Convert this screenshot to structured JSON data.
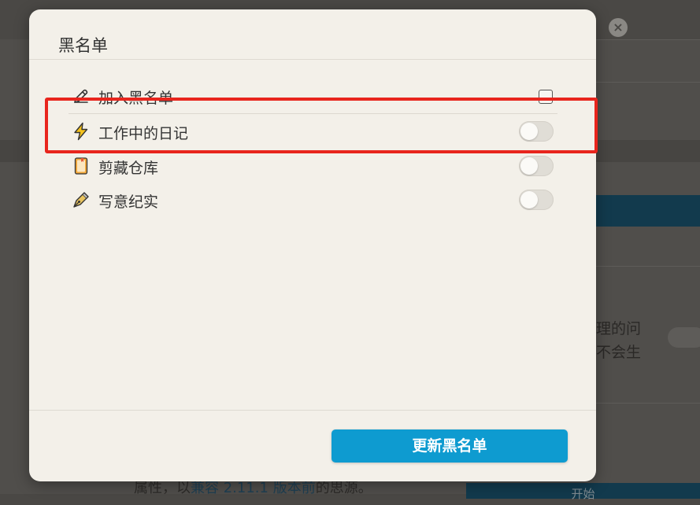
{
  "background": {
    "side_text_1": "理的问",
    "side_text_2": "不会生",
    "footer_before": "属性，以",
    "footer_link": "兼容 2.11.1 版本前",
    "footer_after": "的思源。",
    "bottom_button": "开始"
  },
  "dialog": {
    "title": "黑名单",
    "add_item": {
      "label": "加入黑名单",
      "checked": false,
      "icon": "pencil-icon"
    },
    "notebooks": [
      {
        "label": "工作中的日记",
        "icon": "lightning-icon",
        "enabled": false
      },
      {
        "label": "剪藏仓库",
        "icon": "notebook-icon",
        "enabled": false
      },
      {
        "label": "写意纪实",
        "icon": "fountain-pen-icon",
        "enabled": false
      }
    ],
    "update_button": "更新黑名单"
  },
  "colors": {
    "accent": "#0e9bd0",
    "highlight": "#e8251d",
    "dialog_bg": "#f3f0e9"
  }
}
